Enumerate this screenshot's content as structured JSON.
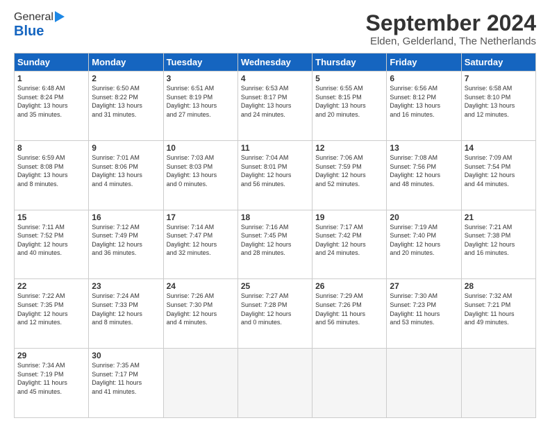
{
  "header": {
    "logo_general": "General",
    "logo_blue": "Blue",
    "month_title": "September 2024",
    "subtitle": "Elden, Gelderland, The Netherlands"
  },
  "calendar": {
    "days_of_week": [
      "Sunday",
      "Monday",
      "Tuesday",
      "Wednesday",
      "Thursday",
      "Friday",
      "Saturday"
    ],
    "weeks": [
      [
        {
          "num": "",
          "empty": true
        },
        {
          "num": "",
          "empty": true
        },
        {
          "num": "",
          "empty": true
        },
        {
          "num": "",
          "empty": true
        },
        {
          "num": "5",
          "info": "Sunrise: 6:55 AM\nSunset: 8:15 PM\nDaylight: 13 hours\nand 20 minutes."
        },
        {
          "num": "6",
          "info": "Sunrise: 6:56 AM\nSunset: 8:12 PM\nDaylight: 13 hours\nand 16 minutes."
        },
        {
          "num": "7",
          "info": "Sunrise: 6:58 AM\nSunset: 8:10 PM\nDaylight: 13 hours\nand 12 minutes."
        }
      ],
      [
        {
          "num": "1",
          "info": "Sunrise: 6:48 AM\nSunset: 8:24 PM\nDaylight: 13 hours\nand 35 minutes."
        },
        {
          "num": "2",
          "info": "Sunrise: 6:50 AM\nSunset: 8:22 PM\nDaylight: 13 hours\nand 31 minutes."
        },
        {
          "num": "3",
          "info": "Sunrise: 6:51 AM\nSunset: 8:19 PM\nDaylight: 13 hours\nand 27 minutes."
        },
        {
          "num": "4",
          "info": "Sunrise: 6:53 AM\nSunset: 8:17 PM\nDaylight: 13 hours\nand 24 minutes."
        },
        {
          "num": "5",
          "info": "Sunrise: 6:55 AM\nSunset: 8:15 PM\nDaylight: 13 hours\nand 20 minutes."
        },
        {
          "num": "6",
          "info": "Sunrise: 6:56 AM\nSunset: 8:12 PM\nDaylight: 13 hours\nand 16 minutes."
        },
        {
          "num": "7",
          "info": "Sunrise: 6:58 AM\nSunset: 8:10 PM\nDaylight: 13 hours\nand 12 minutes."
        }
      ],
      [
        {
          "num": "8",
          "info": "Sunrise: 6:59 AM\nSunset: 8:08 PM\nDaylight: 13 hours\nand 8 minutes."
        },
        {
          "num": "9",
          "info": "Sunrise: 7:01 AM\nSunset: 8:06 PM\nDaylight: 13 hours\nand 4 minutes."
        },
        {
          "num": "10",
          "info": "Sunrise: 7:03 AM\nSunset: 8:03 PM\nDaylight: 13 hours\nand 0 minutes."
        },
        {
          "num": "11",
          "info": "Sunrise: 7:04 AM\nSunset: 8:01 PM\nDaylight: 12 hours\nand 56 minutes."
        },
        {
          "num": "12",
          "info": "Sunrise: 7:06 AM\nSunset: 7:59 PM\nDaylight: 12 hours\nand 52 minutes."
        },
        {
          "num": "13",
          "info": "Sunrise: 7:08 AM\nSunset: 7:56 PM\nDaylight: 12 hours\nand 48 minutes."
        },
        {
          "num": "14",
          "info": "Sunrise: 7:09 AM\nSunset: 7:54 PM\nDaylight: 12 hours\nand 44 minutes."
        }
      ],
      [
        {
          "num": "15",
          "info": "Sunrise: 7:11 AM\nSunset: 7:52 PM\nDaylight: 12 hours\nand 40 minutes."
        },
        {
          "num": "16",
          "info": "Sunrise: 7:12 AM\nSunset: 7:49 PM\nDaylight: 12 hours\nand 36 minutes."
        },
        {
          "num": "17",
          "info": "Sunrise: 7:14 AM\nSunset: 7:47 PM\nDaylight: 12 hours\nand 32 minutes."
        },
        {
          "num": "18",
          "info": "Sunrise: 7:16 AM\nSunset: 7:45 PM\nDaylight: 12 hours\nand 28 minutes."
        },
        {
          "num": "19",
          "info": "Sunrise: 7:17 AM\nSunset: 7:42 PM\nDaylight: 12 hours\nand 24 minutes."
        },
        {
          "num": "20",
          "info": "Sunrise: 7:19 AM\nSunset: 7:40 PM\nDaylight: 12 hours\nand 20 minutes."
        },
        {
          "num": "21",
          "info": "Sunrise: 7:21 AM\nSunset: 7:38 PM\nDaylight: 12 hours\nand 16 minutes."
        }
      ],
      [
        {
          "num": "22",
          "info": "Sunrise: 7:22 AM\nSunset: 7:35 PM\nDaylight: 12 hours\nand 12 minutes."
        },
        {
          "num": "23",
          "info": "Sunrise: 7:24 AM\nSunset: 7:33 PM\nDaylight: 12 hours\nand 8 minutes."
        },
        {
          "num": "24",
          "info": "Sunrise: 7:26 AM\nSunset: 7:30 PM\nDaylight: 12 hours\nand 4 minutes."
        },
        {
          "num": "25",
          "info": "Sunrise: 7:27 AM\nSunset: 7:28 PM\nDaylight: 12 hours\nand 0 minutes."
        },
        {
          "num": "26",
          "info": "Sunrise: 7:29 AM\nSunset: 7:26 PM\nDaylight: 11 hours\nand 56 minutes."
        },
        {
          "num": "27",
          "info": "Sunrise: 7:30 AM\nSunset: 7:23 PM\nDaylight: 11 hours\nand 53 minutes."
        },
        {
          "num": "28",
          "info": "Sunrise: 7:32 AM\nSunset: 7:21 PM\nDaylight: 11 hours\nand 49 minutes."
        }
      ],
      [
        {
          "num": "29",
          "info": "Sunrise: 7:34 AM\nSunset: 7:19 PM\nDaylight: 11 hours\nand 45 minutes."
        },
        {
          "num": "30",
          "info": "Sunrise: 7:35 AM\nSunset: 7:17 PM\nDaylight: 11 hours\nand 41 minutes."
        },
        {
          "num": "",
          "empty": true
        },
        {
          "num": "",
          "empty": true
        },
        {
          "num": "",
          "empty": true
        },
        {
          "num": "",
          "empty": true
        },
        {
          "num": "",
          "empty": true
        }
      ]
    ]
  }
}
